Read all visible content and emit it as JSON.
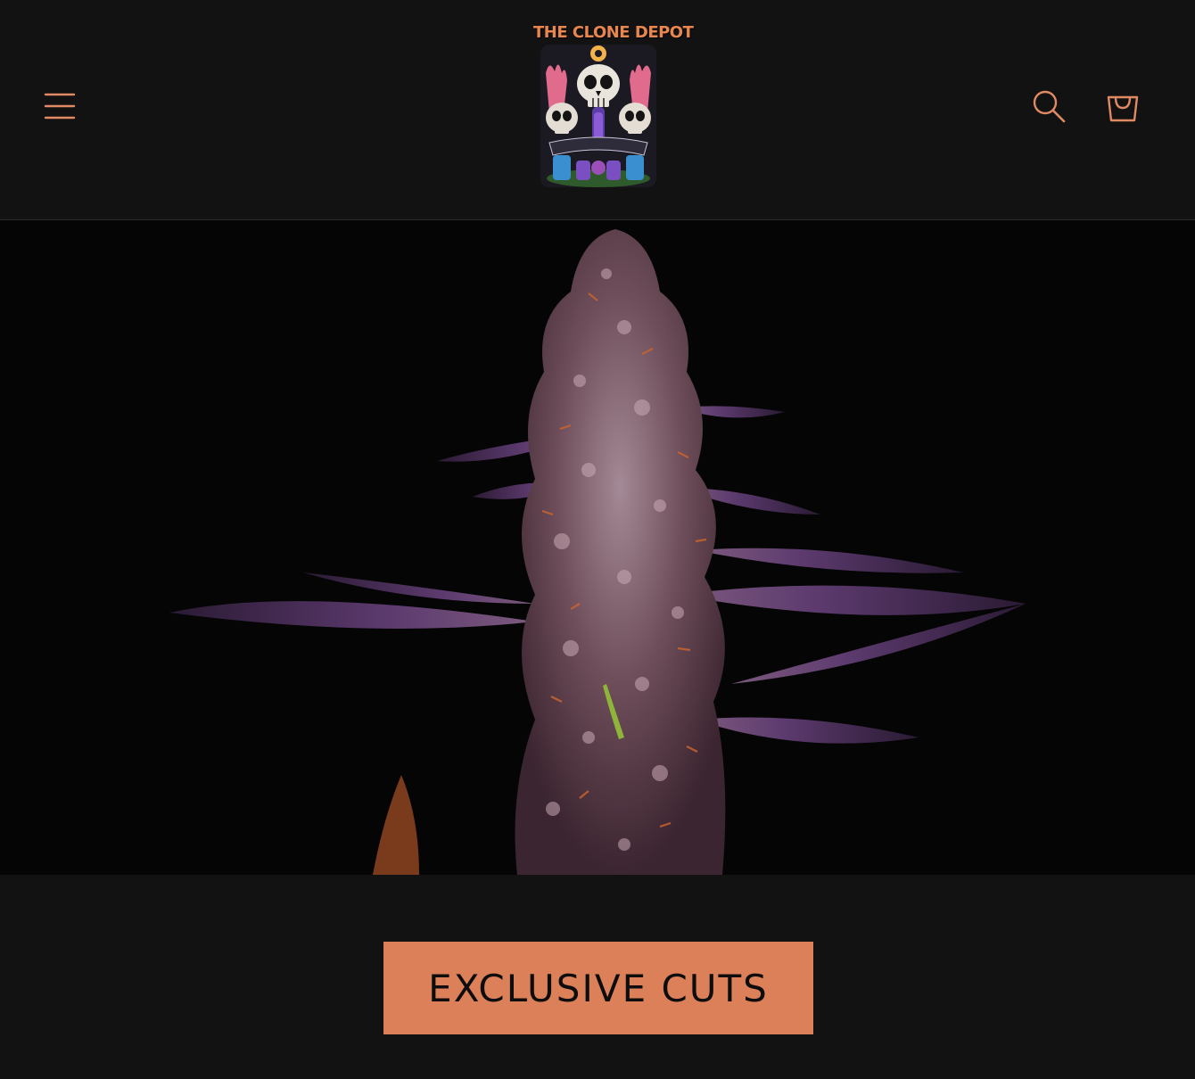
{
  "header": {
    "menu_icon": "hamburger-menu-icon",
    "search_icon": "search-icon",
    "cart_icon": "cart-icon",
    "logo_text": "THE CLONE DEPOT",
    "accent_color": "#dc8059"
  },
  "hero": {
    "image_subject": "cannabis plant photograph"
  },
  "cta": {
    "label": "EXCLUSIVE CUTS",
    "background_color": "#dc8059"
  }
}
